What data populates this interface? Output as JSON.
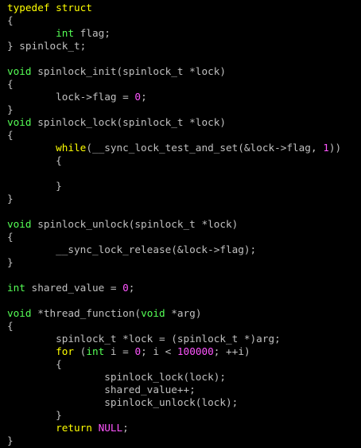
{
  "colors": {
    "background": "#000000",
    "text": "#c0c0c0",
    "keyword": "#ffff00",
    "type": "#55ff55",
    "number": "#ff55ff"
  },
  "editor": {
    "lines": [
      [
        {
          "t": "typedef struct",
          "c": "kw"
        }
      ],
      [
        {
          "t": "{",
          "c": "text"
        }
      ],
      [
        {
          "t": "        ",
          "c": "text"
        },
        {
          "t": "int",
          "c": "type"
        },
        {
          "t": " flag;",
          "c": "text"
        }
      ],
      [
        {
          "t": "} spinlock_t;",
          "c": "text"
        }
      ],
      [],
      [
        {
          "t": "void",
          "c": "type"
        },
        {
          "t": " spinlock_init(spinlock_t *lock)",
          "c": "text"
        }
      ],
      [
        {
          "t": "{",
          "c": "text"
        }
      ],
      [
        {
          "t": "        lock->flag = ",
          "c": "text"
        },
        {
          "t": "0",
          "c": "num"
        },
        {
          "t": ";",
          "c": "text"
        }
      ],
      [
        {
          "t": "}",
          "c": "text"
        }
      ],
      [
        {
          "t": "void",
          "c": "type"
        },
        {
          "t": " spinlock_lock(spinlock_t *lock)",
          "c": "text"
        }
      ],
      [
        {
          "t": "{",
          "c": "text"
        }
      ],
      [
        {
          "t": "        ",
          "c": "text"
        },
        {
          "t": "while",
          "c": "kw"
        },
        {
          "t": "(__sync_lock_test_and_set(&lock->flag, ",
          "c": "text"
        },
        {
          "t": "1",
          "c": "num"
        },
        {
          "t": "))",
          "c": "text"
        }
      ],
      [
        {
          "t": "        {",
          "c": "text"
        }
      ],
      [],
      [
        {
          "t": "        }",
          "c": "text"
        }
      ],
      [
        {
          "t": "}",
          "c": "text"
        }
      ],
      [],
      [
        {
          "t": "void",
          "c": "type"
        },
        {
          "t": " spinlock_unlock(spinlock_t *lock)",
          "c": "text"
        }
      ],
      [
        {
          "t": "{",
          "c": "text"
        }
      ],
      [
        {
          "t": "        __sync_lock_release(&lock->flag);",
          "c": "text"
        }
      ],
      [
        {
          "t": "}",
          "c": "text"
        }
      ],
      [],
      [
        {
          "t": "int",
          "c": "type"
        },
        {
          "t": " shared_value = ",
          "c": "text"
        },
        {
          "t": "0",
          "c": "num"
        },
        {
          "t": ";",
          "c": "text"
        }
      ],
      [],
      [
        {
          "t": "void",
          "c": "type"
        },
        {
          "t": " *thread_function(",
          "c": "text"
        },
        {
          "t": "void",
          "c": "type"
        },
        {
          "t": " *arg)",
          "c": "text"
        }
      ],
      [
        {
          "t": "{",
          "c": "text"
        }
      ],
      [
        {
          "t": "        spinlock_t *lock = (spinlock_t *)arg;",
          "c": "text"
        }
      ],
      [
        {
          "t": "        ",
          "c": "text"
        },
        {
          "t": "for",
          "c": "kw"
        },
        {
          "t": " (",
          "c": "text"
        },
        {
          "t": "int",
          "c": "type"
        },
        {
          "t": " i = ",
          "c": "text"
        },
        {
          "t": "0",
          "c": "num"
        },
        {
          "t": "; i < ",
          "c": "text"
        },
        {
          "t": "100000",
          "c": "num"
        },
        {
          "t": "; ++i)",
          "c": "text"
        }
      ],
      [
        {
          "t": "        {",
          "c": "text"
        }
      ],
      [
        {
          "t": "                spinlock_lock(lock);",
          "c": "text"
        }
      ],
      [
        {
          "t": "                shared_value++;",
          "c": "text"
        }
      ],
      [
        {
          "t": "                spinlock_unlock(lock);",
          "c": "text"
        }
      ],
      [
        {
          "t": "        }",
          "c": "text"
        }
      ],
      [
        {
          "t": "        ",
          "c": "text"
        },
        {
          "t": "return",
          "c": "kw"
        },
        {
          "t": " ",
          "c": "text"
        },
        {
          "t": "NULL",
          "c": "num"
        },
        {
          "t": ";",
          "c": "text"
        }
      ],
      [
        {
          "t": "}",
          "c": "text"
        }
      ]
    ]
  }
}
